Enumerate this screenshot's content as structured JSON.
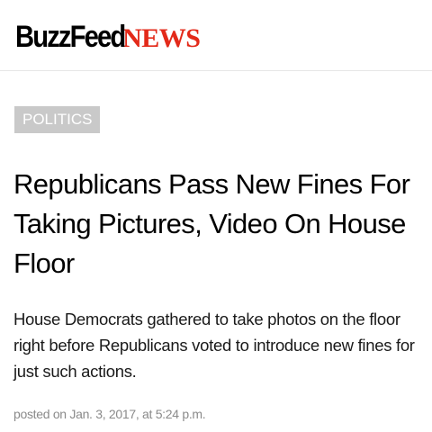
{
  "header": {
    "logo_buzzfeed": "BuzzFeed",
    "logo_news": "NEWS",
    "news_color": "#e32a1a"
  },
  "article": {
    "category": "POLITICS",
    "category_bg": "#c9c9c9",
    "headline": "Republicans Pass New Fines For Taking Pictures, Video On House Floor",
    "dek": "House Democrats gathered to take photos on the floor right before Republicans voted to introduce new fines for just such actions.",
    "timestamp": "posted on Jan. 3, 2017, at 5:24 p.m."
  }
}
